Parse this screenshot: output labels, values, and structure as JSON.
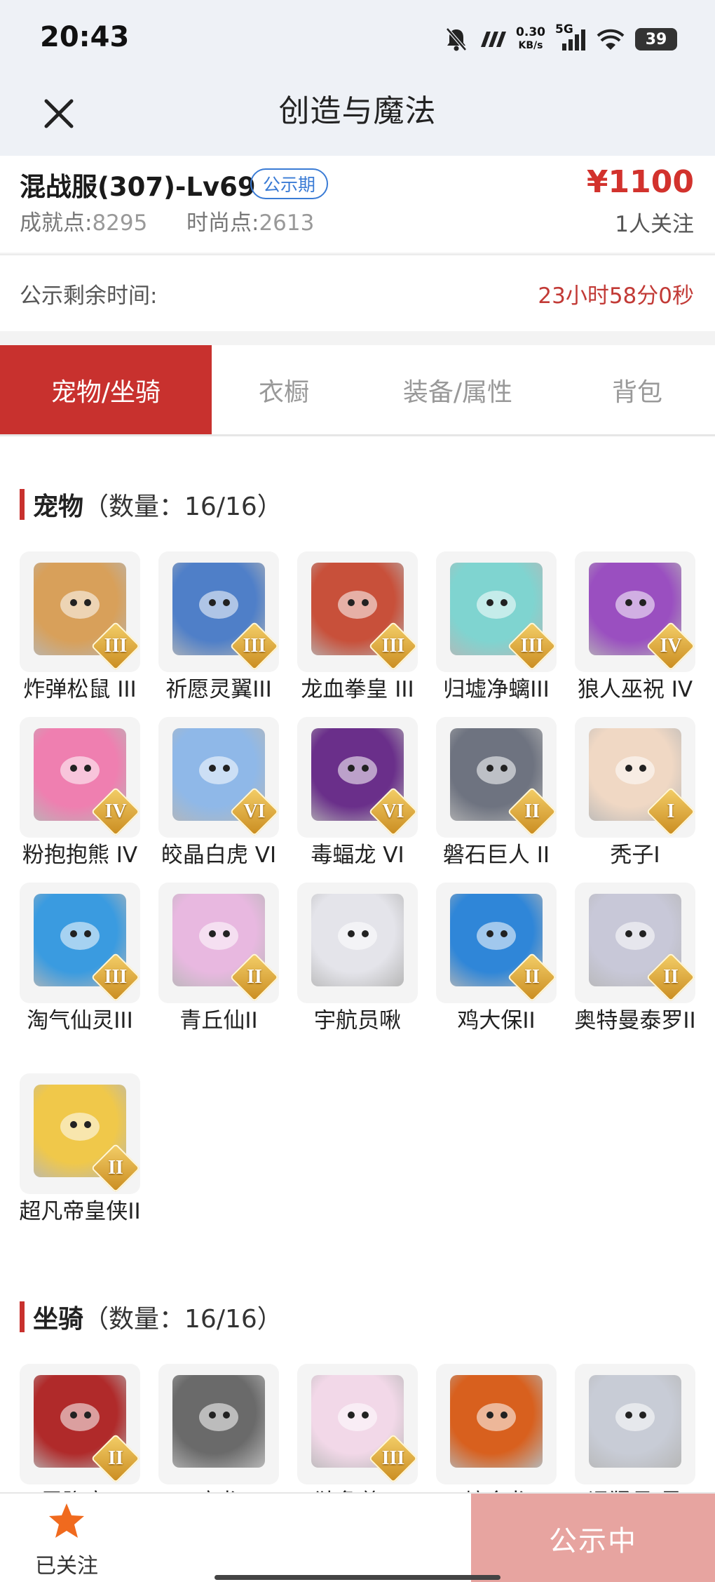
{
  "status_bar": {
    "time": "20:43",
    "net_speed_value": "0.30",
    "net_speed_unit": "KB/s",
    "network": "5G",
    "battery": "39",
    "icons": [
      "mute-bell-icon",
      "signal-icon",
      "wifi-icon",
      "battery-icon"
    ]
  },
  "nav": {
    "title": "创造与魔法",
    "close_icon": "close-icon"
  },
  "listing": {
    "server": "混战服(307)-Lv69",
    "badge": "公示期",
    "price": "¥1100",
    "achievement_label": "成就点:",
    "achievement_value": "8295",
    "fashion_label": "时尚点:",
    "fashion_value": "2613",
    "followers": "1人关注",
    "remaining_label": "公示剩余时间:",
    "remaining_value": "23小时58分0秒"
  },
  "tabs": [
    {
      "label": "宠物/坐骑",
      "active": true
    },
    {
      "label": "衣橱",
      "active": false
    },
    {
      "label": "装备/属性",
      "active": false
    },
    {
      "label": "背包",
      "active": false
    }
  ],
  "pets_section": {
    "title": "宠物",
    "count": "（数量：16/16）",
    "items": [
      {
        "name": "炸弹松鼠 III",
        "grade": "III",
        "color": "#d8a05a"
      },
      {
        "name": "祈愿灵翼III",
        "grade": "III",
        "color": "#4f7fc8"
      },
      {
        "name": "龙血拳皇 III",
        "grade": "III",
        "color": "#c8503a"
      },
      {
        "name": "归墟净螭III",
        "grade": "III",
        "color": "#7fd4d0"
      },
      {
        "name": "狼人巫祝 IV",
        "grade": "IV",
        "color": "#9a4fc0"
      },
      {
        "name": "粉抱抱熊 IV",
        "grade": "IV",
        "color": "#ef7fb0"
      },
      {
        "name": "皎晶白虎 VI",
        "grade": "VI",
        "color": "#8fb8e8"
      },
      {
        "name": "毒蝠龙 VI",
        "grade": "VI",
        "color": "#6a2f8a"
      },
      {
        "name": "磐石巨人 II",
        "grade": "II",
        "color": "#6e7380"
      },
      {
        "name": "秃子I",
        "grade": "I",
        "color": "#f0d8c4"
      },
      {
        "name": "淘气仙灵III",
        "grade": "III",
        "color": "#3a9be0"
      },
      {
        "name": "青丘仙II",
        "grade": "II",
        "color": "#e8b8e0"
      },
      {
        "name": "宇航员啾",
        "grade": "",
        "color": "#e4e4ea"
      },
      {
        "name": "鸡大保II",
        "grade": "II",
        "color": "#2f86d8"
      },
      {
        "name": "奥特曼泰罗II",
        "grade": "II",
        "color": "#c8c8d8"
      },
      {
        "name": "超凡帝皇侠II",
        "grade": "II",
        "color": "#f0c84a"
      }
    ]
  },
  "mounts_section": {
    "title": "坐骑",
    "count": "（数量：16/16）",
    "items": [
      {
        "name": "雷隐鹿II",
        "grade": "II",
        "color": "#b02a2a"
      },
      {
        "name": "应龙",
        "grade": "",
        "color": "#6a6a6a"
      },
      {
        "name": "独角兽III",
        "grade": "III",
        "color": "#f2d8e8"
      },
      {
        "name": "熔金龙",
        "grade": "",
        "color": "#d8601e"
      },
      {
        "name": "迅猛号·星",
        "grade": "",
        "color": "#c8ccd6"
      }
    ]
  },
  "bottom": {
    "follow_label": "已关注",
    "status_label": "公示中",
    "accent": "#c8312e",
    "star_color": "#f06a1e"
  }
}
